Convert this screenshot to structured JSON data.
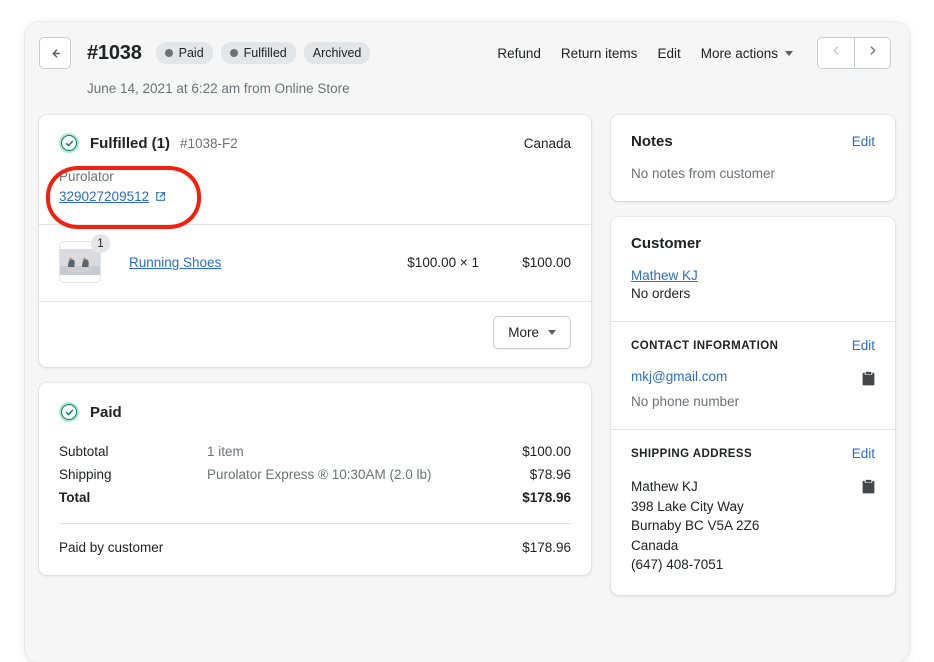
{
  "header": {
    "back_icon": "arrow-left-icon",
    "order_number": "#1038",
    "badges": [
      {
        "label": "Paid",
        "has_dot": true
      },
      {
        "label": "Fulfilled",
        "has_dot": true
      },
      {
        "label": "Archived",
        "has_dot": false
      }
    ],
    "actions": [
      {
        "label": "Refund"
      },
      {
        "label": "Return items"
      },
      {
        "label": "Edit"
      }
    ],
    "more_actions_label": "More actions",
    "prev_icon": "chevron-left-icon",
    "next_icon": "chevron-right-icon",
    "meta": "June 14, 2021 at 6:22 am from Online Store"
  },
  "fulfillment": {
    "status_icon": "check-circle-icon",
    "title": "Fulfilled (1)",
    "reference": "#1038-F2",
    "location": "Canada",
    "carrier": "Purolator",
    "tracking_number": "329027209512",
    "tracking_external_icon": "external-link-icon",
    "line_item": {
      "quantity": "1",
      "thumbnail_icon": "running-shoes-thumbnail",
      "name": "Running Shoes",
      "unit_price": "$100.00 × 1",
      "line_total": "$100.00"
    },
    "more_button_label": "More",
    "more_caret_icon": "chevron-down-icon"
  },
  "payment": {
    "status_icon": "check-circle-icon",
    "title": "Paid",
    "rows": [
      {
        "label": "Subtotal",
        "desc": "1 item",
        "value": "$100.00",
        "bold": false
      },
      {
        "label": "Shipping",
        "desc": "Purolator Express ® 10:30AM (2.0 lb)",
        "value": "$78.96",
        "bold": false
      },
      {
        "label": "Total",
        "desc": "",
        "value": "$178.96",
        "bold": true
      }
    ],
    "paid_by_label": "Paid by customer",
    "paid_by_value": "$178.96"
  },
  "notes": {
    "title": "Notes",
    "edit_label": "Edit",
    "empty_text": "No notes from customer"
  },
  "customer": {
    "title": "Customer",
    "name": "Mathew KJ",
    "orders": "No orders",
    "contact": {
      "title": "CONTACT INFORMATION",
      "edit_label": "Edit",
      "email": "mkj@gmail.com",
      "phone": "No phone number",
      "copy_icon": "clipboard-copy-icon"
    },
    "shipping": {
      "title": "SHIPPING ADDRESS",
      "edit_label": "Edit",
      "copy_icon": "clipboard-copy-icon",
      "lines": [
        "Mathew KJ",
        "398 Lake City Way",
        "Burnaby BC V5A 2Z6",
        "Canada",
        "(647) 408-7051"
      ]
    }
  },
  "annotation": {
    "type": "highlight-oval",
    "color": "#f41f0c",
    "target": "tracking-number"
  },
  "colors": {
    "accent_link": "#2c6ecb",
    "success": "#007f5f",
    "success_bg": "#aee9d1",
    "page_bg": "#f6f6f7",
    "text": "#202223",
    "muted": "#6d7175",
    "annotation": "#f41f0c"
  }
}
